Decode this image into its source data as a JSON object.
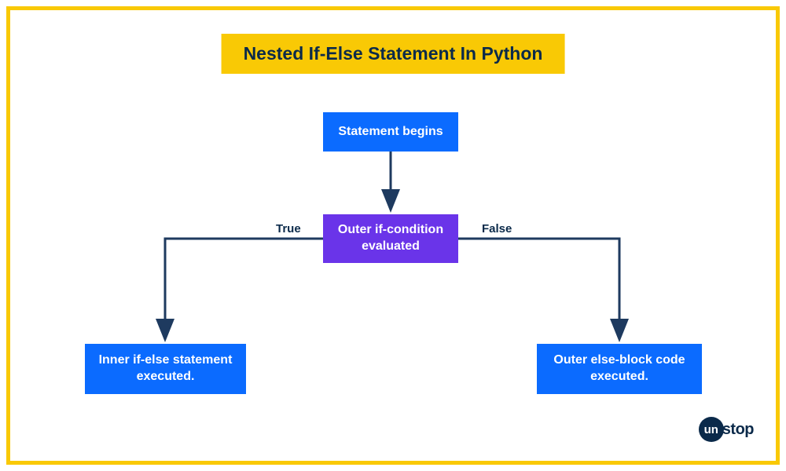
{
  "title": "Nested If-Else Statement In Python",
  "nodes": {
    "start": "Statement begins",
    "condition": "Outer if-condition evaluated",
    "trueBranch": "Inner if-else statement executed.",
    "falseBranch": "Outer else-block code executed."
  },
  "labels": {
    "true": "True",
    "false": "False"
  },
  "logo": {
    "badge": "un",
    "text": "stop"
  },
  "colors": {
    "frame": "#f9c905",
    "blueNode": "#0b6bff",
    "purpleNode": "#6a34e9",
    "arrow": "#1e3a5f",
    "darkText": "#0b2a4a"
  }
}
